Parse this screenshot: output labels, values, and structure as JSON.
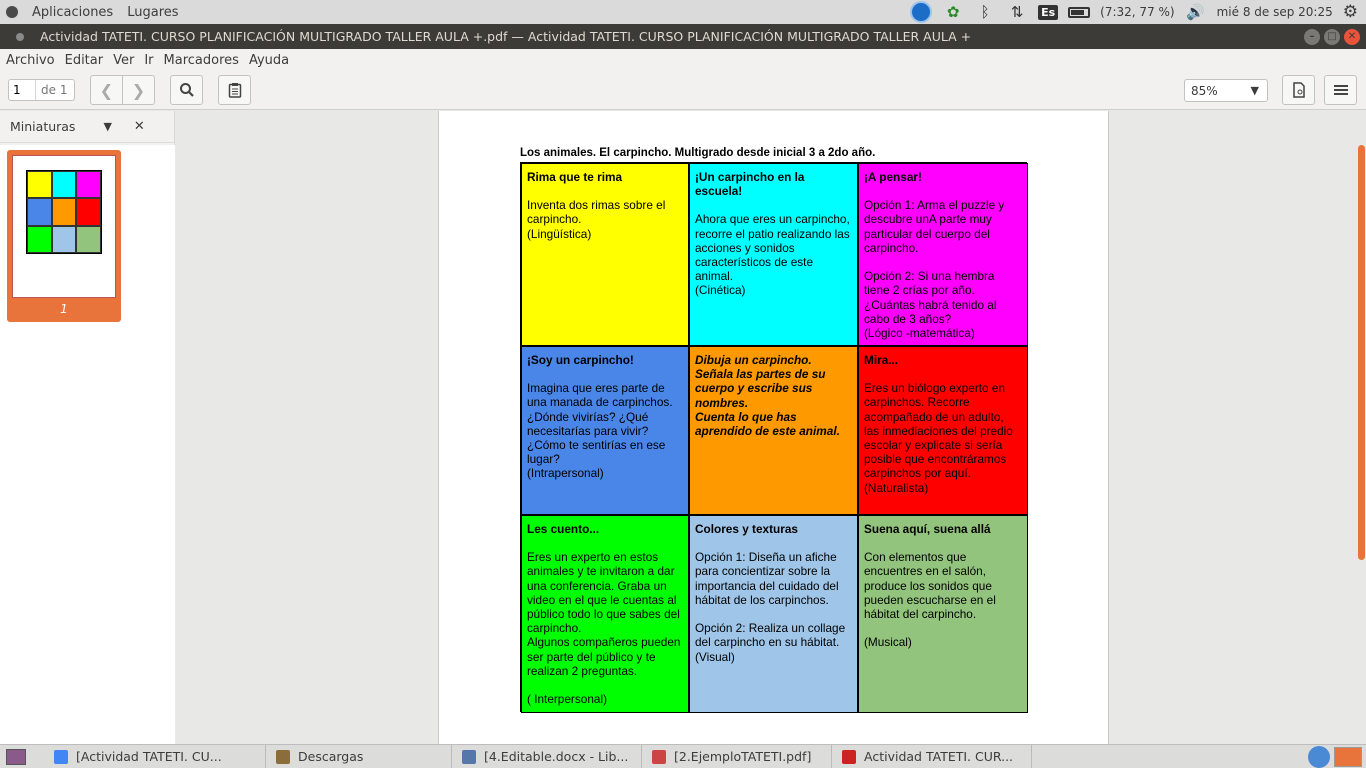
{
  "top_panel": {
    "apps_label": "Aplicaciones",
    "places_label": "Lugares",
    "keyboard": "Es",
    "battery": "(7:32, 77 %)",
    "clock": "mié  8 de sep 20:25"
  },
  "window": {
    "title": "Actividad TATETI. CURSO PLANIFICACIÓN MULTIGRADO TALLER AULA +.pdf — Actividad TATETI. CURSO PLANIFICACIÓN MULTIGRADO TALLER AULA +"
  },
  "menu": [
    "Archivo",
    "Editar",
    "Ver",
    "Ir",
    "Marcadores",
    "Ayuda"
  ],
  "toolbar": {
    "page_value": "1",
    "page_of": "de 1",
    "zoom": "85%"
  },
  "sidebar": {
    "title": "Miniaturas",
    "thumb_label": "1"
  },
  "document": {
    "title": "Los animales. El carpincho. Multigrado desde inicial 3 a 2do año.",
    "cells": [
      {
        "color": "#ffff00",
        "heading": "Rima que te rima",
        "body": "Inventa dos rimas sobre el carpincho.\n(Lingüística)"
      },
      {
        "color": "#00ffff",
        "heading": "¡Un carpincho en la escuela!",
        "body": "Ahora que eres un carpincho, recorre el patio realizando las acciones y sonidos característicos de este animal.\n(Cinética)"
      },
      {
        "color": "#ff00ff",
        "heading": "¡A pensar!",
        "body": "Opción 1: Arma el puzzle y descubre unA parte muy particular del cuerpo del carpincho.\n\nOpción 2: Si una hembra tiene 2 crías por año. ¿Cuántas habrá tenido al cabo de 3 años?\n(Lógico -matemática)"
      },
      {
        "color": "#4a86e8",
        "heading": "¡Soy un carpincho!",
        "body": "Imagina que eres parte de una manada de carpinchos. ¿Dónde vivirías? ¿Qué necesitarías para vivir? ¿Cómo te sentirías en ese lugar?\n(Intrapersonal)"
      },
      {
        "color": "#ff9900",
        "heading": "Dibuja un carpincho.\nSeñala las partes de su cuerpo y escribe sus nombres.\nCuenta lo que has aprendido de este animal.",
        "body": ""
      },
      {
        "color": "#ff0000",
        "heading": " Mira...",
        "body": "Eres un biólogo experto en carpinchos. Recorre acompañado de un adulto, las inmediaciones del predio escolar y explicate si sería posible que encontráramos carpinchos por aquí.\n(Naturalista)"
      },
      {
        "color": "#00ff00",
        "heading": "Les cuento...",
        "body": "Eres un experto en estos animales y te invitaron a dar una conferencia. Graba un video en el que le cuentas al público todo lo que sabes del carpincho.\nAlgunos compañeros pueden ser parte del público y te realizan 2 preguntas.\n\n( Interpersonal)"
      },
      {
        "color": "#9fc5e8",
        "heading": "Colores y texturas",
        "body": "Opción 1: Diseña un afiche para concientizar sobre la importancia del cuidado del hábitat  de los carpinchos.\n\nOpción 2: Realiza un collage del carpincho en su hábitat.\n(Visual)"
      },
      {
        "color": "#93c47d",
        "heading": "Suena aquí, suena allá",
        "body": "Con elementos que encuentres en el salón, produce los sonidos que pueden escucharse en el hábitat del carpincho.\n\n(Musical)"
      }
    ]
  },
  "taskbar": {
    "items": [
      {
        "label": "[Actividad TATETI. CU...",
        "icon_color": "#4285f4"
      },
      {
        "label": "Descargas",
        "icon_color": "#8a6d3b"
      },
      {
        "label": "[4.Editable.docx - Lib...",
        "icon_color": "#5577aa"
      },
      {
        "label": "[2.EjemploTATETI.pdf]",
        "icon_color": "#cc4444"
      },
      {
        "label": "Actividad TATETI. CUR...",
        "icon_color": "#cc2222"
      }
    ]
  },
  "colors": {
    "accent": "#e9743b",
    "titlebar": "#3c3b37"
  }
}
